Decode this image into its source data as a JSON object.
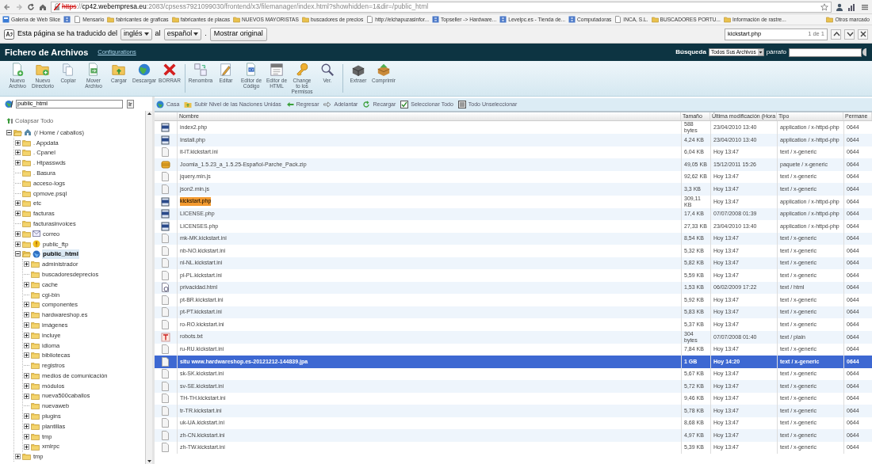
{
  "browser": {
    "scheme": "https",
    "separator": "://",
    "insecure": true,
    "host": "cp42.webempresa.eu",
    "path": ":2083/cpsess7921099030/frontend/x3/filemanager/index.html?showhidden=1&dir=/public_html"
  },
  "bookmarks": [
    {
      "kind": "slice",
      "label": "Galería de Web Slice"
    },
    {
      "kind": "site"
    },
    {
      "kind": "page",
      "label": "Mensario"
    },
    {
      "kind": "folder",
      "label": "fabricantes de graficas"
    },
    {
      "kind": "folder",
      "label": "fabricantes de placas"
    },
    {
      "kind": "folder",
      "label": "NUEVOS MAYORISTAS"
    },
    {
      "kind": "folder",
      "label": "buscadores de precios"
    },
    {
      "kind": "page",
      "label": "http://elchapuzasinfor..."
    },
    {
      "kind": "site",
      "label": "Topseller -> Hardware..."
    },
    {
      "kind": "site",
      "label": "Levelpc.es - Tienda de..."
    },
    {
      "kind": "site",
      "label": "Computadoras"
    },
    {
      "kind": "page",
      "label": "INCA, S.L."
    },
    {
      "kind": "folder",
      "label": "BUSCADORES PORTU..."
    },
    {
      "kind": "folder",
      "label": "Información de rastre..."
    }
  ],
  "other_bookmarks": "Otros marcado",
  "translate": {
    "prefix": "Esta página se ha traducido del",
    "from": "inglés",
    "joiner": "al",
    "to": "español",
    "suffix": ".",
    "button": "Mostrar original"
  },
  "find": {
    "query": "kickstart.php",
    "count": "1 de 1"
  },
  "app": {
    "title": "Fichero de Archivos",
    "config_link": "Configurations",
    "search_label": "Búsqueda",
    "search_scope": "Todos Sus Archivos",
    "search_for": "párrafo"
  },
  "toolbar": {
    "groups": [
      [
        {
          "lines": [
            "Nuevo",
            "Archivo"
          ]
        },
        {
          "lines": [
            "Nuevo",
            "Directorio"
          ]
        },
        {
          "lines": [
            "Copiar"
          ]
        },
        {
          "lines": [
            "Mover",
            "Archivo"
          ]
        },
        {
          "lines": [
            "Cargar"
          ]
        },
        {
          "lines": [
            "Descargar"
          ]
        },
        {
          "lines": [
            "BORRAR"
          ]
        }
      ],
      [
        {
          "lines": [
            "Renombra"
          ]
        },
        {
          "lines": [
            "Editar"
          ]
        },
        {
          "lines": [
            "Editor de",
            "Código"
          ]
        },
        {
          "lines": [
            "Editor de",
            "HTML"
          ]
        },
        {
          "lines": [
            "Change",
            "to los",
            "Permisos"
          ]
        },
        {
          "lines": [
            "Ver."
          ]
        }
      ],
      [
        {
          "lines": [
            "Extraer"
          ]
        },
        {
          "lines": [
            "Comprimir"
          ]
        }
      ]
    ]
  },
  "path": {
    "value": "public_html",
    "go": "Ir"
  },
  "nav": [
    "Casa",
    "Subir Nivel de las Naciones Unidas",
    "Regresar",
    "Adelantar",
    "Recargar",
    "Seleccionar Todo",
    "Todo Unseleccionar"
  ],
  "tree": {
    "collapse_all": "Colapsar Todo",
    "items": [
      {
        "label": "(/ Home / caballos)",
        "kind": "home",
        "expandable": true,
        "expanded": true,
        "selected": false,
        "children": [
          {
            "label": ". Appdata",
            "kind": "folder",
            "expandable": true,
            "expanded": false,
            "selected": false
          },
          {
            "label": ". Cpanel",
            "kind": "folder",
            "expandable": true,
            "expanded": false,
            "selected": false
          },
          {
            "label": ". Htpasswds",
            "kind": "folder",
            "expandable": true,
            "expanded": false,
            "selected": false
          },
          {
            "label": ". Basura",
            "kind": "folder",
            "expandable": false,
            "expanded": false,
            "selected": false
          },
          {
            "label": "acceso-logs",
            "kind": "folder",
            "expandable": false,
            "expanded": false,
            "selected": false
          },
          {
            "label": "cpmove.psql",
            "kind": "folder",
            "expandable": false,
            "expanded": false,
            "selected": false
          },
          {
            "label": "etc",
            "kind": "folder",
            "expandable": true,
            "expanded": false,
            "selected": false
          },
          {
            "label": "facturas",
            "kind": "folder",
            "expandable": true,
            "expanded": false,
            "selected": false
          },
          {
            "label": "facturasinvoices",
            "kind": "folder",
            "expandable": false,
            "expanded": false,
            "selected": false
          },
          {
            "label": "correo",
            "kind": "mail",
            "expandable": true,
            "expanded": false,
            "selected": false
          },
          {
            "label": "public_ftp",
            "kind": "ftp",
            "expandable": true,
            "expanded": false,
            "selected": false
          },
          {
            "label": "public_html",
            "kind": "web",
            "expandable": true,
            "expanded": true,
            "selected": true,
            "children": [
              {
                "label": "administrador",
                "kind": "folder",
                "expandable": true,
                "expanded": false,
                "selected": false
              },
              {
                "label": "buscadoresdeprecios",
                "kind": "folder",
                "expandable": false,
                "expanded": false,
                "selected": false
              },
              {
                "label": "cache",
                "kind": "folder",
                "expandable": true,
                "expanded": false,
                "selected": false
              },
              {
                "label": "cgi-bin",
                "kind": "folder",
                "expandable": false,
                "expanded": false,
                "selected": false
              },
              {
                "label": "componentes",
                "kind": "folder",
                "expandable": true,
                "expanded": false,
                "selected": false
              },
              {
                "label": "hardwareshop.es",
                "kind": "folder",
                "expandable": true,
                "expanded": false,
                "selected": false
              },
              {
                "label": "imágenes",
                "kind": "folder",
                "expandable": true,
                "expanded": false,
                "selected": false
              },
              {
                "label": "incluye",
                "kind": "folder",
                "expandable": true,
                "expanded": false,
                "selected": false
              },
              {
                "label": "idioma",
                "kind": "folder",
                "expandable": true,
                "expanded": false,
                "selected": false
              },
              {
                "label": "bibliotecas",
                "kind": "folder",
                "expandable": true,
                "expanded": false,
                "selected": false
              },
              {
                "label": "registros",
                "kind": "folder",
                "expandable": false,
                "expanded": false,
                "selected": false
              },
              {
                "label": "medios de comunicación",
                "kind": "folder",
                "expandable": true,
                "expanded": false,
                "selected": false
              },
              {
                "label": "módulos",
                "kind": "folder",
                "expandable": true,
                "expanded": false,
                "selected": false
              },
              {
                "label": "nueva500caballos",
                "kind": "folder",
                "expandable": true,
                "expanded": false,
                "selected": false
              },
              {
                "label": "nuevaweb",
                "kind": "folder",
                "expandable": false,
                "expanded": false,
                "selected": false
              },
              {
                "label": "plugins",
                "kind": "folder",
                "expandable": true,
                "expanded": false,
                "selected": false
              },
              {
                "label": "plantillas",
                "kind": "folder",
                "expandable": true,
                "expanded": false,
                "selected": false
              },
              {
                "label": "tmp",
                "kind": "folder",
                "expandable": true,
                "expanded": false,
                "selected": false
              },
              {
                "label": "xmlrpc",
                "kind": "folder",
                "expandable": true,
                "expanded": false,
                "selected": false
              }
            ]
          },
          {
            "label": "tmp",
            "kind": "folder",
            "expandable": true,
            "expanded": false,
            "selected": false
          }
        ]
      }
    ]
  },
  "table": {
    "columns": [
      "Nombre",
      "Tamaño",
      "Última modificación (Hora",
      "Tipo",
      "Permane"
    ],
    "rows": [
      {
        "kind": "php",
        "name": "index2.php",
        "size": "588 bytes",
        "modified": "23/04/2010 13:40",
        "type": "application / x-httpd-php",
        "perms": "0644",
        "selected": false,
        "find_match": false
      },
      {
        "kind": "php",
        "name": "Install.php",
        "size": "4,24 KB",
        "modified": "23/04/2010 13:40",
        "type": "application / x-httpd-php",
        "perms": "0644",
        "selected": false,
        "find_match": false
      },
      {
        "kind": "generic",
        "name": "it-IT.kickstart.ini",
        "size": "6,04 KB",
        "modified": "Hoy 13:47",
        "type": "text / x-generic",
        "perms": "0644",
        "selected": false,
        "find_match": false
      },
      {
        "kind": "zip",
        "name": "Joomla_1.5.23_a_1.5.25-Español-Parche_Pack.zip",
        "size": "49,05 KB",
        "modified": "15/12/2011 15:26",
        "type": "paquete / x-generic",
        "perms": "0644",
        "selected": false,
        "find_match": false
      },
      {
        "kind": "generic",
        "name": "jquery.min.js",
        "size": "92,62 KB",
        "modified": "Hoy 13:47",
        "type": "text / x-generic",
        "perms": "0644",
        "selected": false,
        "find_match": false
      },
      {
        "kind": "generic",
        "name": "json2.min.js",
        "size": "3,3 KB",
        "modified": "Hoy 13:47",
        "type": "text / x-generic",
        "perms": "0644",
        "selected": false,
        "find_match": false
      },
      {
        "kind": "php",
        "name": "kickstart.php",
        "size": "309,11 KB",
        "modified": "Hoy 13:47",
        "type": "application / x-httpd-php",
        "perms": "0644",
        "selected": false,
        "find_match": true
      },
      {
        "kind": "php",
        "name": "LICENSE.php",
        "size": "17,4 KB",
        "modified": "07/07/2008 01:39",
        "type": "application / x-httpd-php",
        "perms": "0644",
        "selected": false,
        "find_match": false
      },
      {
        "kind": "php",
        "name": "LICENSES.php",
        "size": "27,33 KB",
        "modified": "23/04/2010 13:40",
        "type": "application / x-httpd-php",
        "perms": "0644",
        "selected": false,
        "find_match": false
      },
      {
        "kind": "generic",
        "name": "mk-MK.kickstart.ini",
        "size": "8,54 KB",
        "modified": "Hoy 13:47",
        "type": "text / x-generic",
        "perms": "0644",
        "selected": false,
        "find_match": false
      },
      {
        "kind": "generic",
        "name": "nb-NO.kickstart.ini",
        "size": "5,32 KB",
        "modified": "Hoy 13:47",
        "type": "text / x-generic",
        "perms": "0644",
        "selected": false,
        "find_match": false
      },
      {
        "kind": "generic",
        "name": "nl-NL.kickstart.ini",
        "size": "5,82 KB",
        "modified": "Hoy 13:47",
        "type": "text / x-generic",
        "perms": "0644",
        "selected": false,
        "find_match": false
      },
      {
        "kind": "generic",
        "name": "pl-PL.kickstart.ini",
        "size": "5,59 KB",
        "modified": "Hoy 13:47",
        "type": "text / x-generic",
        "perms": "0644",
        "selected": false,
        "find_match": false
      },
      {
        "kind": "html",
        "name": "privacidad.html",
        "size": "1,53 KB",
        "modified": "06/02/2009 17:22",
        "type": "text / html",
        "perms": "0644",
        "selected": false,
        "find_match": false
      },
      {
        "kind": "generic",
        "name": "pt-BR.kickstart.ini",
        "size": "5,92 KB",
        "modified": "Hoy 13:47",
        "type": "text / x-generic",
        "perms": "0644",
        "selected": false,
        "find_match": false
      },
      {
        "kind": "generic",
        "name": "pt-PT.kickstart.ini",
        "size": "5,83 KB",
        "modified": "Hoy 13:47",
        "type": "text / x-generic",
        "perms": "0644",
        "selected": false,
        "find_match": false
      },
      {
        "kind": "generic",
        "name": "ro-RO.kickstart.ini",
        "size": "5,37 KB",
        "modified": "Hoy 13:47",
        "type": "text / x-generic",
        "perms": "0644",
        "selected": false,
        "find_match": false
      },
      {
        "kind": "text",
        "name": "robots.txt",
        "size": "304 bytes",
        "modified": "07/07/2008 01:40",
        "type": "text / plain",
        "perms": "0644",
        "selected": false,
        "find_match": false
      },
      {
        "kind": "generic",
        "name": "ru-RU.kickstart.ini",
        "size": "7,84 KB",
        "modified": "Hoy 13:47",
        "type": "text / x-generic",
        "perms": "0644",
        "selected": false,
        "find_match": false
      },
      {
        "kind": "generic",
        "name": "situ www.hardwareshop.es-20121212-144839.jpa",
        "size": "1 GB",
        "modified": "Hoy 14:20",
        "type": "text / x-generic",
        "perms": "0644",
        "selected": true,
        "find_match": false
      },
      {
        "kind": "generic",
        "name": "sk-SK.kickstart.ini",
        "size": "5,67 KB",
        "modified": "Hoy 13:47",
        "type": "text / x-generic",
        "perms": "0644",
        "selected": false,
        "find_match": false
      },
      {
        "kind": "generic",
        "name": "sv-SE.kickstart.ini",
        "size": "5,72 KB",
        "modified": "Hoy 13:47",
        "type": "text / x-generic",
        "perms": "0644",
        "selected": false,
        "find_match": false
      },
      {
        "kind": "generic",
        "name": "TH-TH.kickstart.ini",
        "size": "9,46 KB",
        "modified": "Hoy 13:47",
        "type": "text / x-generic",
        "perms": "0644",
        "selected": false,
        "find_match": false
      },
      {
        "kind": "generic",
        "name": "tr-TR.kickstart.ini",
        "size": "5,78 KB",
        "modified": "Hoy 13:47",
        "type": "text / x-generic",
        "perms": "0644",
        "selected": false,
        "find_match": false
      },
      {
        "kind": "generic",
        "name": "uk-UA.kickstart.ini",
        "size": "8,68 KB",
        "modified": "Hoy 13:47",
        "type": "text / x-generic",
        "perms": "0644",
        "selected": false,
        "find_match": false
      },
      {
        "kind": "generic",
        "name": "zh-CN.kickstart.ini",
        "size": "4,97 KB",
        "modified": "Hoy 13:47",
        "type": "text / x-generic",
        "perms": "0644",
        "selected": false,
        "find_match": false
      },
      {
        "kind": "generic",
        "name": "zh-TW.kickstart.ini",
        "size": "5,39 KB",
        "modified": "Hoy 13:47",
        "type": "text / x-generic",
        "perms": "0644",
        "selected": false,
        "find_match": false
      }
    ]
  }
}
